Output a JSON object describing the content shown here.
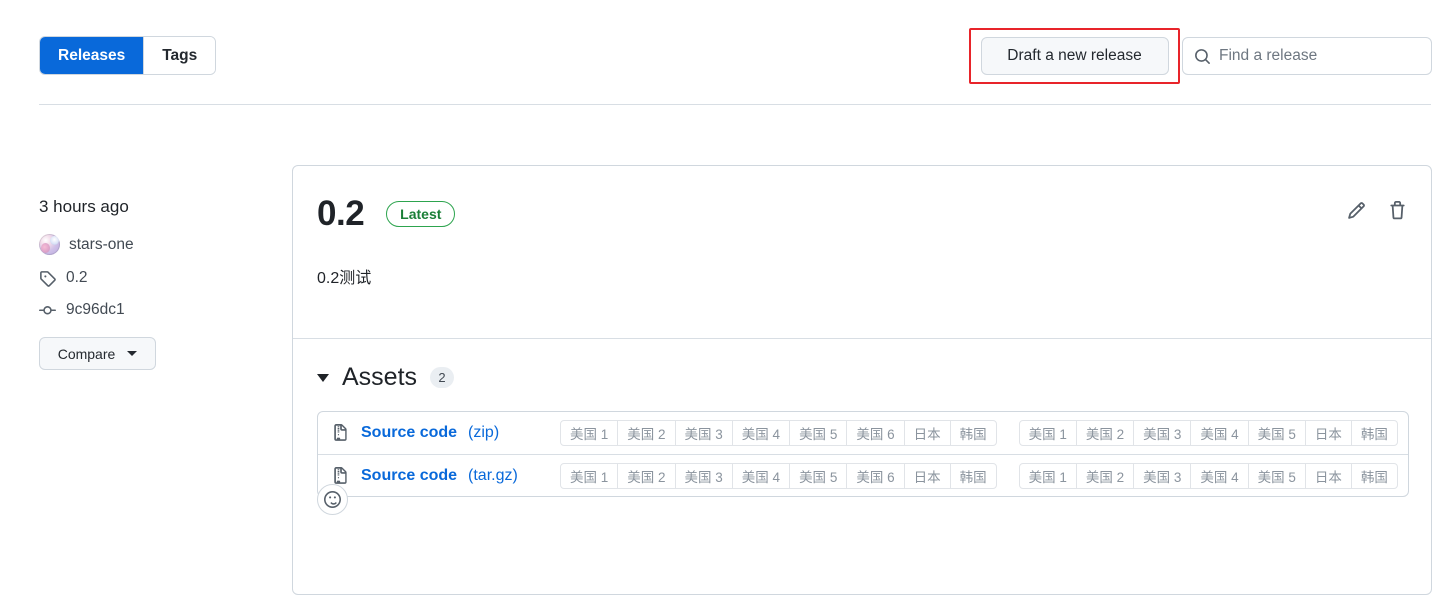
{
  "header": {
    "tabs": [
      {
        "label": "Releases",
        "active": true
      },
      {
        "label": "Tags",
        "active": false
      }
    ],
    "draft_button": "Draft a new release",
    "search": {
      "placeholder": "Find a release",
      "value": ""
    },
    "highlight_color": "#e8242a",
    "accent_color": "#0969da"
  },
  "sidebar": {
    "date": "3 hours ago",
    "author": "stars-one",
    "tag": "0.2",
    "commit": "9c96dc1",
    "compare_label": "Compare"
  },
  "release": {
    "title": "0.2",
    "badge": "Latest",
    "badge_color": "#1a7f37",
    "description": "0.2测试",
    "edit_icon": "pencil-icon",
    "delete_icon": "trash-icon"
  },
  "assets": {
    "title": "Assets",
    "count": "2",
    "expanded": true,
    "rows": [
      {
        "name": "Source code",
        "ext": "(zip)",
        "icon": "file-zip-icon",
        "mirror_groups": [
          [
            "美国 1",
            "美国 2",
            "美国 3",
            "美国 4",
            "美国 5",
            "美国 6",
            "日本",
            "韩国"
          ],
          [
            "美国 1",
            "美国 2",
            "美国 3",
            "美国 4",
            "美国 5",
            "日本",
            "韩国"
          ]
        ]
      },
      {
        "name": "Source code",
        "ext": "(tar.gz)",
        "icon": "file-zip-icon",
        "mirror_groups": [
          [
            "美国 1",
            "美国 2",
            "美国 3",
            "美国 4",
            "美国 5",
            "美国 6",
            "日本",
            "韩国"
          ],
          [
            "美国 1",
            "美国 2",
            "美国 3",
            "美国 4",
            "美国 5",
            "日本",
            "韩国"
          ]
        ]
      }
    ]
  },
  "reaction": {
    "icon": "smiley-icon"
  }
}
